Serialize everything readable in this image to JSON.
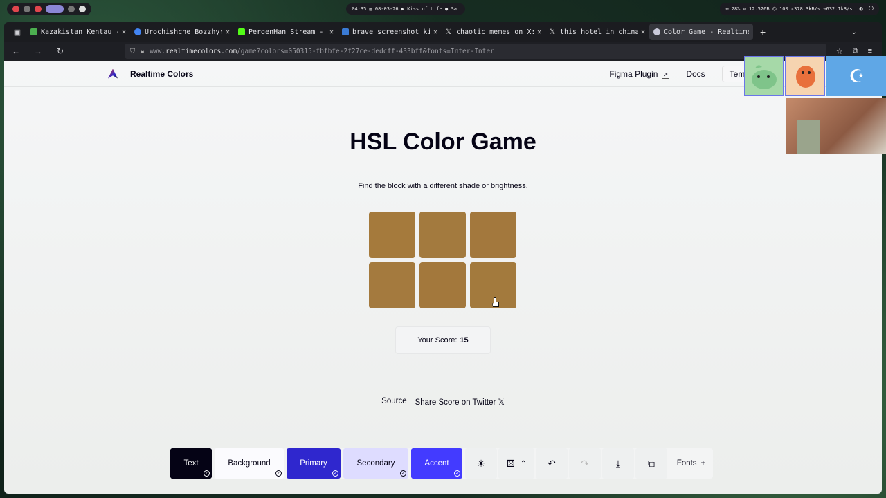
{
  "system": {
    "center_text": "04:35 ▤ 08-03-26 ▶ Kiss of Life ● Sa…",
    "right_text": "⊕ 28%  ⊘ 12.526B  ⌬ 100  ⇊378.3kB/s  ⇈632.1kB/s"
  },
  "tabs": [
    {
      "title": "Kazakistan Kentau - G",
      "favicon_color": "#4caf50",
      "active": false
    },
    {
      "title": "Urochishche Bozzhyra",
      "favicon_color": "#4285f4",
      "active": false
    },
    {
      "title": "PergenHan Stream - Ki",
      "favicon_color": "#53fc18",
      "active": false
    },
    {
      "title": "brave screenshot kick",
      "favicon_color": "#3a7bd5",
      "active": false
    },
    {
      "title": "chaotic memes on X: \"",
      "favicon_color": "#dddddd",
      "active": false
    },
    {
      "title": "this hotel in china s",
      "favicon_color": "#dddddd",
      "active": false
    },
    {
      "title": "Color Game - Realtime",
      "favicon_color": "#c9c9d9",
      "active": true
    }
  ],
  "url": {
    "prefix": "www.",
    "host": "realtimecolors.com",
    "path": "/game?colors=050315-fbfbfe-2f27ce-dedcff-433bff&fonts=Inter-Inter"
  },
  "header": {
    "site_name": "Realtime Colors",
    "figma": "Figma Plugin",
    "docs": "Docs",
    "temp": "Temp"
  },
  "game": {
    "title": "HSL Color Game",
    "subtitle": "Find the block with a different shade or brightness.",
    "score_label": "Your Score:",
    "score_value": "15",
    "blocks": [
      "#a57a3c",
      "#a37a3e",
      "#a3783d",
      "#a47a3e",
      "#a3783c",
      "#a37a3d"
    ]
  },
  "links": {
    "source": "Source",
    "share": "Share Score on Twitter 𝕏"
  },
  "toolbar": {
    "text": "Text",
    "background": "Background",
    "primary": "Primary",
    "secondary": "Secondary",
    "accent": "Accent",
    "fonts": "Fonts"
  },
  "colors": {
    "text": "#050315",
    "background": "#fbfbfe",
    "primary": "#2f27ce",
    "secondary": "#dedcff",
    "accent": "#433bff"
  }
}
